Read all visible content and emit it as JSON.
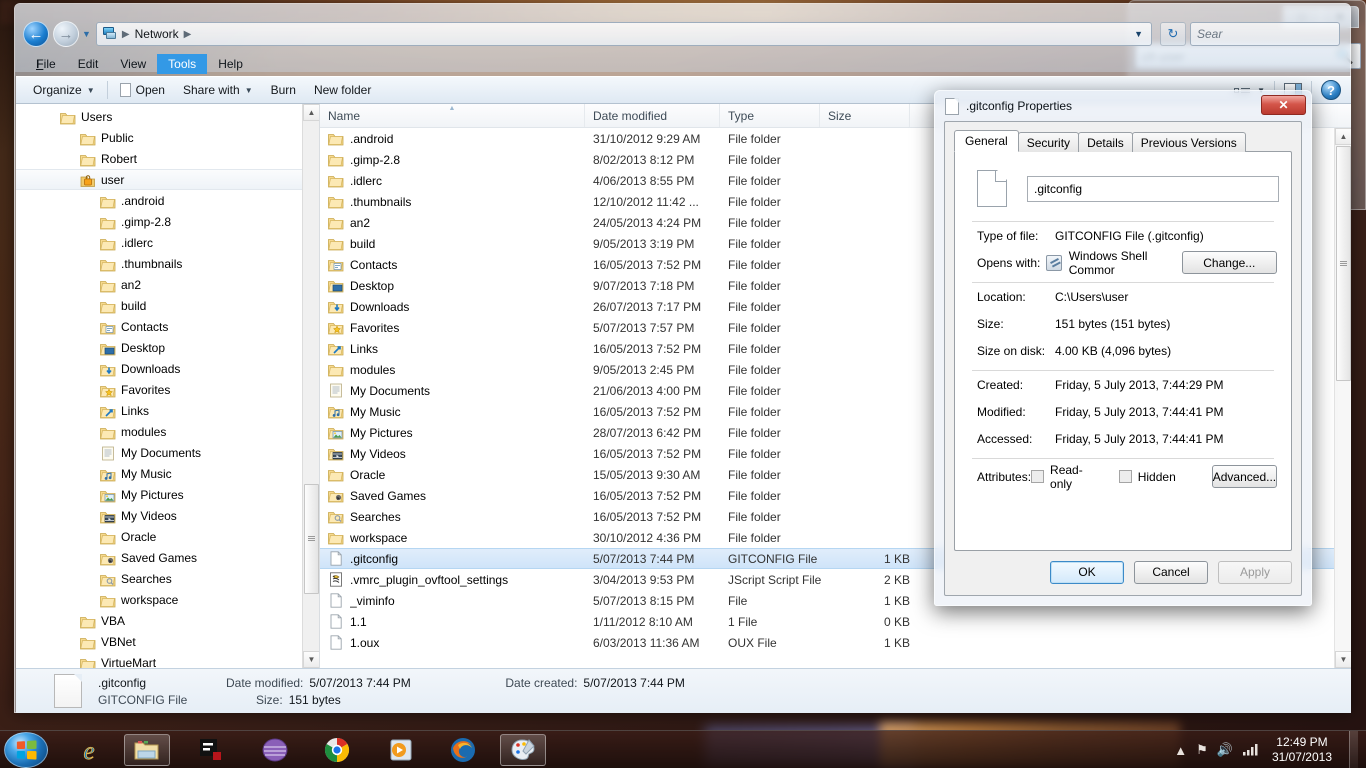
{
  "desktop": {},
  "bg_window": {
    "maximize_label": "□",
    "close_label": "✕",
    "search_placeholder": "ch user",
    "search_icon": "search-icon"
  },
  "explorer": {
    "address": {
      "breadcrumb": [
        "Network"
      ],
      "back_label": "←",
      "forward_label": "→",
      "history_caret": "▼",
      "dropdown_caret": "▼",
      "refresh_label": "↻",
      "search_placeholder": "Sear"
    },
    "menubar": [
      {
        "label": "File",
        "active": false
      },
      {
        "label": "Edit",
        "active": false
      },
      {
        "label": "View",
        "active": false
      },
      {
        "label": "Tools",
        "active": true
      },
      {
        "label": "Help",
        "active": false
      }
    ],
    "toolbar": {
      "organize": "Organize",
      "open": "Open",
      "share_with": "Share with",
      "burn": "Burn",
      "new_folder": "New folder",
      "caret": "▼",
      "help_label": "?"
    },
    "nav_pane": [
      {
        "label": "Users",
        "indent": 0,
        "icon": "folder",
        "selected": false
      },
      {
        "label": "Public",
        "indent": 1,
        "icon": "folder",
        "selected": false
      },
      {
        "label": "Robert",
        "indent": 1,
        "icon": "folder",
        "selected": false
      },
      {
        "label": "user",
        "indent": 1,
        "icon": "folder-lock",
        "selected": true
      },
      {
        "label": ".android",
        "indent": 2,
        "icon": "folder",
        "selected": false
      },
      {
        "label": ".gimp-2.8",
        "indent": 2,
        "icon": "folder",
        "selected": false
      },
      {
        "label": ".idlerc",
        "indent": 2,
        "icon": "folder",
        "selected": false
      },
      {
        "label": ".thumbnails",
        "indent": 2,
        "icon": "folder",
        "selected": false
      },
      {
        "label": "an2",
        "indent": 2,
        "icon": "folder",
        "selected": false
      },
      {
        "label": "build",
        "indent": 2,
        "icon": "folder",
        "selected": false
      },
      {
        "label": "Contacts",
        "indent": 2,
        "icon": "folder-contacts",
        "selected": false
      },
      {
        "label": "Desktop",
        "indent": 2,
        "icon": "folder-desktop",
        "selected": false
      },
      {
        "label": "Downloads",
        "indent": 2,
        "icon": "folder-downloads",
        "selected": false
      },
      {
        "label": "Favorites",
        "indent": 2,
        "icon": "folder-favorites",
        "selected": false
      },
      {
        "label": "Links",
        "indent": 2,
        "icon": "folder-links",
        "selected": false
      },
      {
        "label": "modules",
        "indent": 2,
        "icon": "folder",
        "selected": false
      },
      {
        "label": "My Documents",
        "indent": 2,
        "icon": "folder-documents",
        "selected": false
      },
      {
        "label": "My Music",
        "indent": 2,
        "icon": "folder-music",
        "selected": false
      },
      {
        "label": "My Pictures",
        "indent": 2,
        "icon": "folder-pictures",
        "selected": false
      },
      {
        "label": "My Videos",
        "indent": 2,
        "icon": "folder-videos",
        "selected": false
      },
      {
        "label": "Oracle",
        "indent": 2,
        "icon": "folder",
        "selected": false
      },
      {
        "label": "Saved Games",
        "indent": 2,
        "icon": "folder-saved-games",
        "selected": false
      },
      {
        "label": "Searches",
        "indent": 2,
        "icon": "folder-searches",
        "selected": false
      },
      {
        "label": "workspace",
        "indent": 2,
        "icon": "folder",
        "selected": false
      },
      {
        "label": "VBA",
        "indent": 1,
        "icon": "folder",
        "selected": false
      },
      {
        "label": "VBNet",
        "indent": 1,
        "icon": "folder",
        "selected": false
      },
      {
        "label": "VirtueMart",
        "indent": 1,
        "icon": "folder",
        "selected": false
      }
    ],
    "columns": [
      {
        "key": "name",
        "label": "Name",
        "sorted": true
      },
      {
        "key": "date",
        "label": "Date modified",
        "sorted": false
      },
      {
        "key": "type",
        "label": "Type",
        "sorted": false
      },
      {
        "key": "size",
        "label": "Size",
        "sorted": false
      }
    ],
    "files": [
      {
        "name": ".android",
        "date": "31/10/2012 9:29 AM",
        "type": "File folder",
        "size": "",
        "icon": "folder",
        "selected": false
      },
      {
        "name": ".gimp-2.8",
        "date": "8/02/2013 8:12 PM",
        "type": "File folder",
        "size": "",
        "icon": "folder",
        "selected": false
      },
      {
        "name": ".idlerc",
        "date": "4/06/2013 8:55 PM",
        "type": "File folder",
        "size": "",
        "icon": "folder",
        "selected": false
      },
      {
        "name": ".thumbnails",
        "date": "12/10/2012 11:42 ...",
        "type": "File folder",
        "size": "",
        "icon": "folder",
        "selected": false
      },
      {
        "name": "an2",
        "date": "24/05/2013 4:24 PM",
        "type": "File folder",
        "size": "",
        "icon": "folder",
        "selected": false
      },
      {
        "name": "build",
        "date": "9/05/2013 3:19 PM",
        "type": "File folder",
        "size": "",
        "icon": "folder",
        "selected": false
      },
      {
        "name": "Contacts",
        "date": "16/05/2013 7:52 PM",
        "type": "File folder",
        "size": "",
        "icon": "folder-contacts",
        "selected": false
      },
      {
        "name": "Desktop",
        "date": "9/07/2013 7:18 PM",
        "type": "File folder",
        "size": "",
        "icon": "folder-desktop",
        "selected": false
      },
      {
        "name": "Downloads",
        "date": "26/07/2013 7:17 PM",
        "type": "File folder",
        "size": "",
        "icon": "folder-downloads",
        "selected": false
      },
      {
        "name": "Favorites",
        "date": "5/07/2013 7:57 PM",
        "type": "File folder",
        "size": "",
        "icon": "folder-favorites",
        "selected": false
      },
      {
        "name": "Links",
        "date": "16/05/2013 7:52 PM",
        "type": "File folder",
        "size": "",
        "icon": "folder-links",
        "selected": false
      },
      {
        "name": "modules",
        "date": "9/05/2013 2:45 PM",
        "type": "File folder",
        "size": "",
        "icon": "folder",
        "selected": false
      },
      {
        "name": "My Documents",
        "date": "21/06/2013 4:00 PM",
        "type": "File folder",
        "size": "",
        "icon": "folder-documents",
        "selected": false
      },
      {
        "name": "My Music",
        "date": "16/05/2013 7:52 PM",
        "type": "File folder",
        "size": "",
        "icon": "folder-music",
        "selected": false
      },
      {
        "name": "My Pictures",
        "date": "28/07/2013 6:42 PM",
        "type": "File folder",
        "size": "",
        "icon": "folder-pictures",
        "selected": false
      },
      {
        "name": "My Videos",
        "date": "16/05/2013 7:52 PM",
        "type": "File folder",
        "size": "",
        "icon": "folder-videos",
        "selected": false
      },
      {
        "name": "Oracle",
        "date": "15/05/2013 9:30 AM",
        "type": "File folder",
        "size": "",
        "icon": "folder",
        "selected": false
      },
      {
        "name": "Saved Games",
        "date": "16/05/2013 7:52 PM",
        "type": "File folder",
        "size": "",
        "icon": "folder-saved-games",
        "selected": false
      },
      {
        "name": "Searches",
        "date": "16/05/2013 7:52 PM",
        "type": "File folder",
        "size": "",
        "icon": "folder-searches",
        "selected": false
      },
      {
        "name": "workspace",
        "date": "30/10/2012 4:36 PM",
        "type": "File folder",
        "size": "",
        "icon": "folder",
        "selected": false
      },
      {
        "name": ".gitconfig",
        "date": "5/07/2013 7:44 PM",
        "type": "GITCONFIG File",
        "size": "1 KB",
        "icon": "file",
        "selected": true
      },
      {
        "name": ".vmrc_plugin_ovftool_settings",
        "date": "3/04/2013 9:53 PM",
        "type": "JScript Script File",
        "size": "2 KB",
        "icon": "file-script",
        "selected": false
      },
      {
        "name": "_viminfo",
        "date": "5/07/2013 8:15 PM",
        "type": "File",
        "size": "1 KB",
        "icon": "file",
        "selected": false
      },
      {
        "name": "1.1",
        "date": "1/11/2012 8:10 AM",
        "type": "1 File",
        "size": "0 KB",
        "icon": "file",
        "selected": false
      },
      {
        "name": "1.oux",
        "date": "6/03/2013 11:36 AM",
        "type": "OUX File",
        "size": "1 KB",
        "icon": "file",
        "selected": false
      }
    ],
    "details_pane": {
      "file_name": ".gitconfig",
      "file_type": "GITCONFIG File",
      "date_modified_label": "Date modified:",
      "date_modified_value": "5/07/2013 7:44 PM",
      "date_created_label": "Date created:",
      "date_created_value": "5/07/2013 7:44 PM",
      "size_label": "Size:",
      "size_value": "151 bytes"
    }
  },
  "properties_dialog": {
    "title": ".gitconfig Properties",
    "close_label": "✕",
    "tabs": [
      {
        "label": "General",
        "active": true
      },
      {
        "label": "Security",
        "active": false
      },
      {
        "label": "Details",
        "active": false
      },
      {
        "label": "Previous Versions",
        "active": false
      }
    ],
    "file_name_value": ".gitconfig",
    "rows": [
      {
        "label": "Type of file:",
        "value": "GITCONFIG File (.gitconfig)"
      },
      {
        "label": "Opens with:",
        "value": "Windows Shell Commor"
      },
      {
        "label": "Location:",
        "value": "C:\\Users\\user"
      },
      {
        "label": "Size:",
        "value": "151 bytes (151 bytes)"
      },
      {
        "label": "Size on disk:",
        "value": "4.00 KB (4,096 bytes)"
      },
      {
        "label": "Created:",
        "value": "Friday, 5 July 2013, 7:44:29 PM"
      },
      {
        "label": "Modified:",
        "value": "Friday, 5 July 2013, 7:44:41 PM"
      },
      {
        "label": "Accessed:",
        "value": "Friday, 5 July 2013, 7:44:41 PM"
      },
      {
        "label": "Attributes:",
        "value": ""
      }
    ],
    "change_button": "Change...",
    "advanced_button": "Advanced...",
    "attr_readonly_label": "Read-only",
    "attr_hidden_label": "Hidden",
    "attr_readonly_checked": false,
    "attr_hidden_checked": false,
    "ok_button": "OK",
    "cancel_button": "Cancel",
    "apply_button": "Apply"
  },
  "taskbar": {
    "start_label": "Start",
    "apps": [
      {
        "name": "internet-explorer",
        "active": false
      },
      {
        "name": "windows-explorer",
        "active": true
      },
      {
        "name": "text-editor",
        "active": false
      },
      {
        "name": "purple-app",
        "active": false
      },
      {
        "name": "google-chrome",
        "active": false
      },
      {
        "name": "media-player",
        "active": false
      },
      {
        "name": "mozilla-firefox",
        "active": false
      },
      {
        "name": "paint",
        "active": true
      }
    ],
    "tray": {
      "show_hidden_label": "▲",
      "network_label": "⚑",
      "volume_label": "🔊",
      "signal_label": "▃",
      "time": "12:49 PM",
      "date": "31/07/2013"
    }
  }
}
